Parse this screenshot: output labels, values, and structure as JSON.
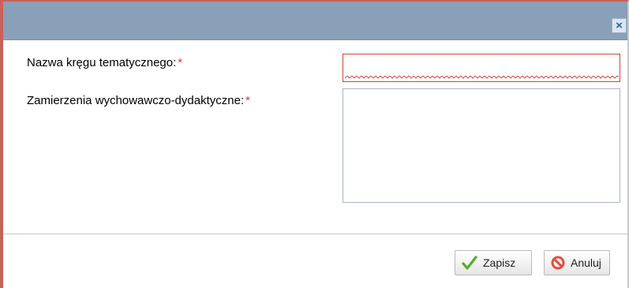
{
  "dialog": {
    "close_label": "×"
  },
  "form": {
    "name_label": "Nazwa kręgu tematycznego:",
    "name_required": "*",
    "name_value": "",
    "goals_label": "Zamierzenia wychowawczo-dydaktyczne:",
    "goals_required": "*",
    "goals_value": ""
  },
  "buttons": {
    "save_label": "Zapisz",
    "save_icon": "checkmark-icon",
    "cancel_label": "Anuluj",
    "cancel_icon": "cancel-icon"
  },
  "colors": {
    "titlebar": "#8aa0b8",
    "required_mark": "#e03030",
    "invalid_border": "#d2462e",
    "save_icon": "#5aaa28",
    "cancel_icon": "#e05040"
  }
}
